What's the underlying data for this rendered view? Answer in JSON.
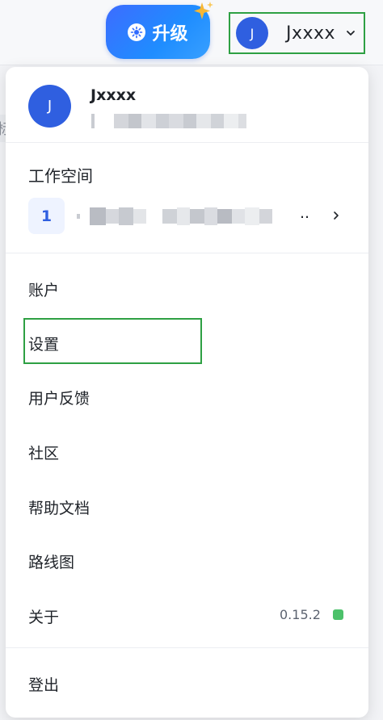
{
  "header": {
    "upgrade_label": "升级",
    "user_avatar_initial": "J",
    "user_name": "Jxxxx"
  },
  "background": {
    "tag_text": "标签"
  },
  "profile": {
    "avatar_initial": "J",
    "name": "Jxxxx"
  },
  "workspace": {
    "section_title": "工作空间",
    "badge": "1",
    "name_suffix": ".."
  },
  "menu": {
    "account": "账户",
    "settings": "设置",
    "feedback": "用户反馈",
    "community": "社区",
    "docs": "帮助文档",
    "roadmap": "路线图",
    "about": "关于",
    "version": "0.15.2",
    "logout": "登出"
  },
  "colors": {
    "accent": "#2f5fe0",
    "highlight_border": "#2ea043",
    "status_dot": "#4cc16a"
  }
}
